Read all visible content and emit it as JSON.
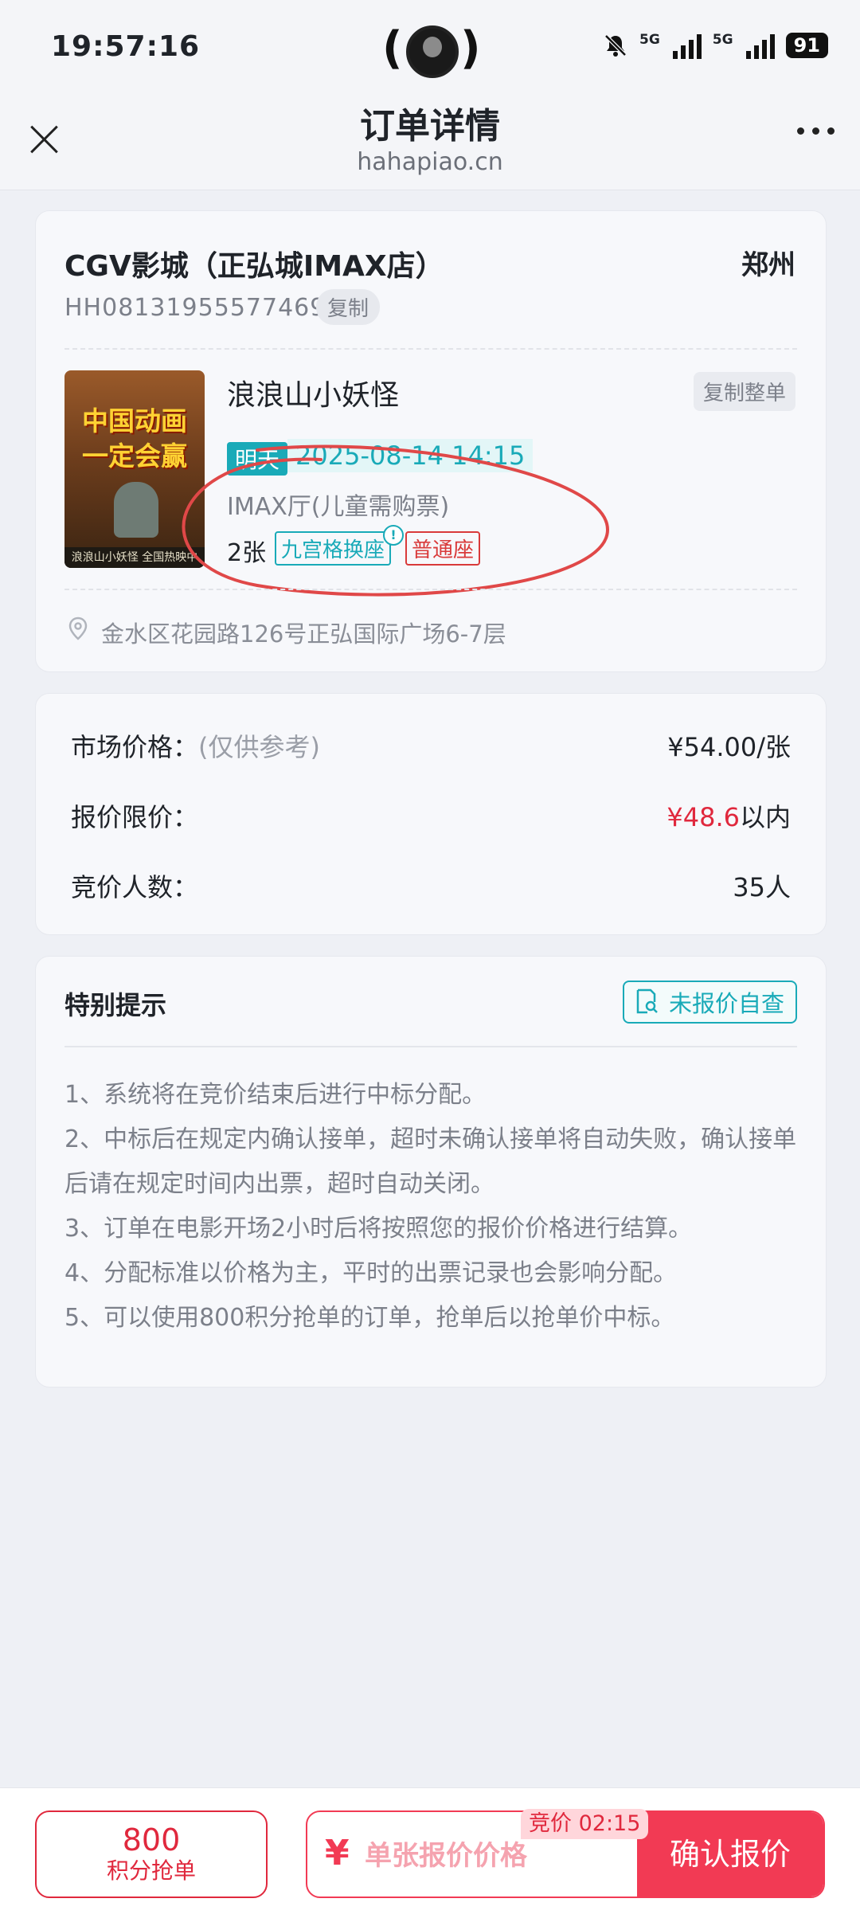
{
  "status_bar": {
    "time": "19:57:16",
    "network_1": "5G",
    "network_2": "5G",
    "battery": "91"
  },
  "header": {
    "title": "订单详情",
    "subtitle": "hahapiao.cn"
  },
  "order": {
    "cinema": "CGV影城（正弘城IMAX店）",
    "city": "郑州",
    "order_no": "HH081319555774693",
    "copy_label": "复制",
    "poster_title": "中国动画一定会赢",
    "poster_caption": "浪浪山小妖怪 全国热映中",
    "movie_title": "浪浪山小妖怪",
    "copy_all_label": "复制整单",
    "day": "明天",
    "datetime": "2025-08-14 14:15",
    "hall": "IMAX厅(儿童需购票)",
    "quantity": "2张",
    "seat_tag_1": "九宫格换座",
    "seat_tag_2": "普通座",
    "info_mark": "!",
    "address": "金水区花园路126号正弘国际广场6-7层"
  },
  "pricing": {
    "market_label": "市场价格：",
    "market_note": "(仅供参考)",
    "market_value": "¥54.00/张",
    "limit_label": "报价限价：",
    "limit_value": "¥48.6",
    "limit_suffix": "以内",
    "bidders_label": "竞价人数：",
    "bidders_value": "35人"
  },
  "tips": {
    "title": "特别提示",
    "check_button": "未报价自查",
    "items": [
      "1、系统将在竞价结束后进行中标分配。",
      "2、中标后在规定内确认接单，超时未确认接单将自动失败，确认接单后请在规定时间内出票，超时自动关闭。",
      "3、订单在电影开场2小时后将按照您的报价价格进行结算。",
      "4、分配标准以价格为主，平时的出票记录也会影响分配。",
      "5、可以使用800积分抢单的订单，抢单后以抢单价中标。"
    ]
  },
  "bottom": {
    "points": "800",
    "points_label": "积分抢单",
    "currency": "¥",
    "price_placeholder": "单张报价价格",
    "countdown": "竞价 02:15",
    "confirm": "确认报价"
  },
  "colors": {
    "accent_teal": "#19aab8",
    "accent_red": "#f23a54",
    "price_red": "#e0283d",
    "background": "#eef0f5"
  }
}
